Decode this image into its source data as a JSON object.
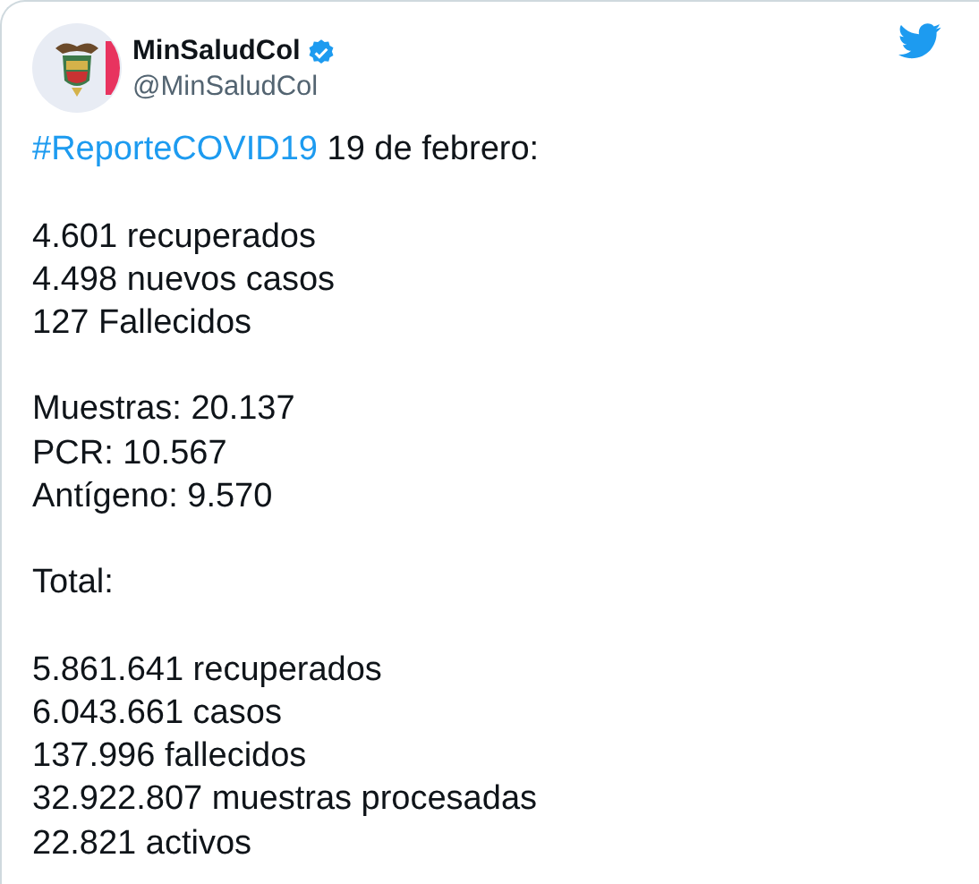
{
  "author": {
    "name": "MinSaludCol",
    "handle": "@MinSaludCol",
    "verified": true
  },
  "text": {
    "hashtag": "#ReporteCOVID19",
    "headline": "19 de febrero:"
  },
  "paragraphs": [
    [
      "4.601 recuperados",
      "4.498 nuevos casos",
      "127 Fallecidos"
    ],
    [
      "Muestras: 20.137",
      "PCR: 10.567",
      "Antígeno: 9.570"
    ],
    [
      "Total:"
    ],
    [
      "5.861.641 recuperados",
      "6.043.661 casos",
      "137.996 fallecidos",
      "32.922.807 muestras procesadas",
      "22.821 activos"
    ]
  ]
}
